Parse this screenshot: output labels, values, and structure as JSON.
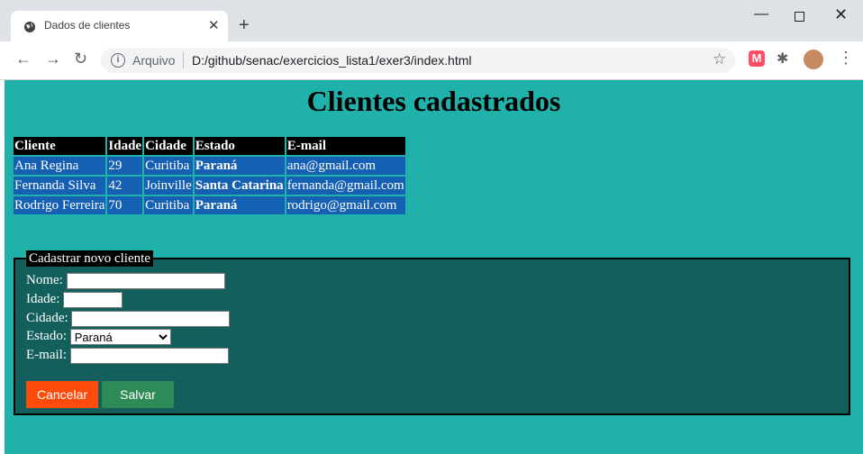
{
  "browser": {
    "tab_title": "Dados de clientes",
    "tab_close": "✕",
    "new_tab": "+",
    "address_label": "Arquivo",
    "url": "D:/github/senac/exercicios_lista1/exer3/index.html",
    "controls": {
      "back": "←",
      "forward": "→",
      "reload": "↻",
      "star": "☆",
      "min": "—",
      "close": "✕",
      "menu": "⋮",
      "ext_m": "M",
      "puzzle": "✱",
      "info": "i"
    }
  },
  "page": {
    "title": "Clientes cadastrados",
    "table": {
      "headers": [
        "Cliente",
        "Idade",
        "Cidade",
        "Estado",
        "E-mail"
      ],
      "rows": [
        [
          "Ana Regina",
          "29",
          "Curitiba",
          "Paraná",
          "ana@gmail.com"
        ],
        [
          "Fernanda Silva",
          "42",
          "Joinville",
          "Santa Catarina",
          "fernanda@gmail.com"
        ],
        [
          "Rodrigo Ferreira",
          "70",
          "Curitiba",
          "Paraná",
          "rodrigo@gmail.com"
        ]
      ]
    },
    "form": {
      "legend": "Cadastrar novo cliente",
      "nome_label": "Nome:",
      "nome_value": "",
      "idade_label": "Idade:",
      "idade_value": "",
      "cidade_label": "Cidade:",
      "cidade_value": "",
      "estado_label": "Estado:",
      "estado_selected": "Paraná",
      "email_label": "E-mail:",
      "email_value": "",
      "cancel_label": "Cancelar",
      "save_label": "Salvar"
    }
  },
  "colors": {
    "page_bg": "#20b2aa",
    "table_cell_bg": "#1660b4",
    "form_bg": "#135f5b",
    "cancel_bg": "#fc4b0a",
    "save_bg": "#2e8b57"
  }
}
